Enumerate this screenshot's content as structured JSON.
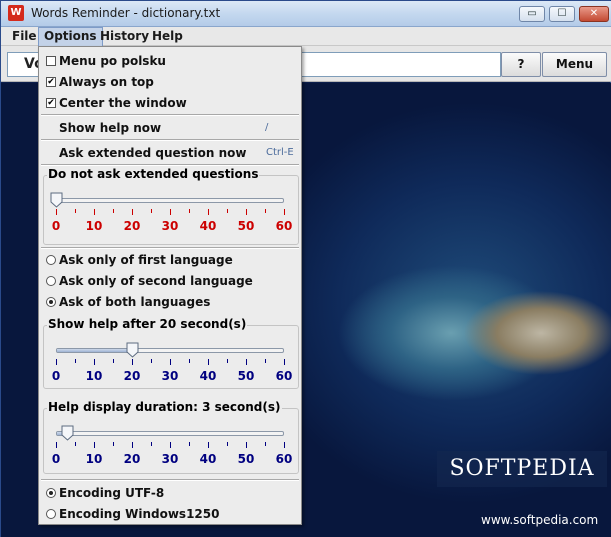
{
  "window": {
    "title": "Words Reminder - dictionary.txt",
    "controls": {
      "minimize": "▭",
      "maximize": "☐",
      "close": "✕"
    }
  },
  "menubar": [
    "File",
    "Options",
    "History",
    "Help"
  ],
  "toolbar": {
    "word_value": "Vo",
    "help_button": "?",
    "menu_button": "Menu"
  },
  "watermark": {
    "logo": "SOFTPEDIA",
    "url": "www.softpedia.com"
  },
  "options_menu": {
    "checks": [
      {
        "label": "Menu po polsku",
        "checked": false
      },
      {
        "label": "Always on top",
        "checked": true
      },
      {
        "label": "Center the window",
        "checked": true
      }
    ],
    "show_help_now": {
      "label": "Show help now",
      "accel": "/"
    },
    "ask_extended": {
      "label": "Ask extended question now",
      "accel": "Ctrl-E"
    },
    "extended_group": {
      "title": "Do not ask extended questions",
      "value": 0,
      "color": "#cc0000"
    },
    "language_radios": [
      {
        "label": "Ask only of first language",
        "selected": false
      },
      {
        "label": "Ask only of second language",
        "selected": false
      },
      {
        "label": "Ask of both languages",
        "selected": true
      }
    ],
    "show_help_group": {
      "title": "Show help after 20 second(s)",
      "value": 20,
      "color": "#000080"
    },
    "duration_group": {
      "title": "Help display duration: 3 second(s)",
      "value": 3,
      "color": "#000080"
    },
    "scale": {
      "min": 0,
      "max": 60,
      "labels": [
        "0",
        "10",
        "20",
        "30",
        "40",
        "50",
        "60"
      ]
    },
    "encoding_radios": [
      {
        "label": "Encoding UTF-8",
        "selected": true
      },
      {
        "label": "Encoding Windows1250",
        "selected": false
      }
    ]
  }
}
